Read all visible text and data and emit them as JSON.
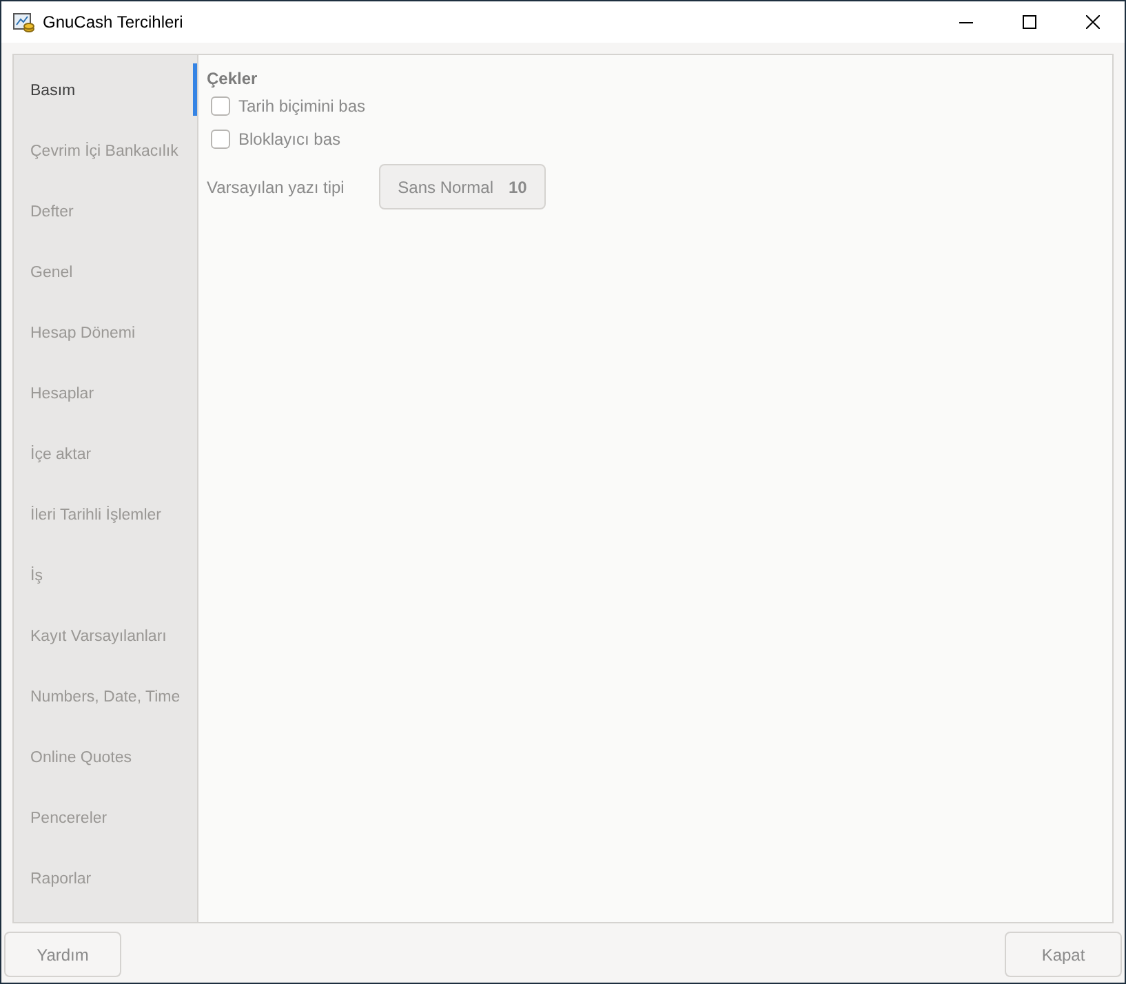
{
  "window": {
    "title": "GnuCash Tercihleri"
  },
  "sidebar": {
    "items": [
      {
        "label": "Basım",
        "selected": true
      },
      {
        "label": "Çevrim İçi Bankacılık",
        "selected": false
      },
      {
        "label": "Defter",
        "selected": false
      },
      {
        "label": "Genel",
        "selected": false
      },
      {
        "label": "Hesap Dönemi",
        "selected": false
      },
      {
        "label": "Hesaplar",
        "selected": false
      },
      {
        "label": "İçe aktar",
        "selected": false
      },
      {
        "label": "İleri Tarihli İşlemler",
        "selected": false
      },
      {
        "label": "İş",
        "selected": false
      },
      {
        "label": "Kayıt Varsayılanları",
        "selected": false
      },
      {
        "label": "Numbers, Date, Time",
        "selected": false
      },
      {
        "label": "Online Quotes",
        "selected": false
      },
      {
        "label": "Pencereler",
        "selected": false
      },
      {
        "label": "Raporlar",
        "selected": false
      }
    ]
  },
  "section": {
    "heading": "Çekler",
    "options": [
      {
        "label": "Tarih biçimini bas",
        "checked": false
      },
      {
        "label": "Bloklayıcı bas",
        "checked": false
      }
    ],
    "font": {
      "label": "Varsayılan yazı tipi",
      "name": "Sans Normal",
      "size": "10"
    }
  },
  "help_button": {
    "label": "Yardım"
  },
  "close_button": {
    "label": "Kapat"
  }
}
